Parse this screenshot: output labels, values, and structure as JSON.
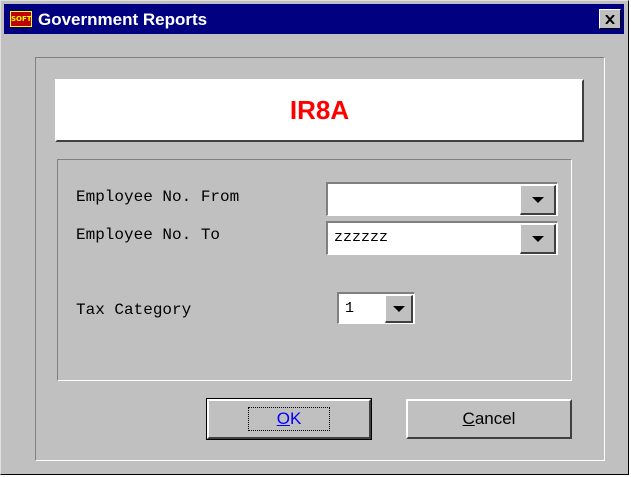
{
  "window": {
    "title": "Government Reports",
    "app_icon_text": "SOFT",
    "close_glyph": "X"
  },
  "report": {
    "title": "IR8A"
  },
  "form": {
    "employee_from": {
      "label": "Employee No. From",
      "value": ""
    },
    "employee_to": {
      "label": "Employee No. To",
      "value": "zzzzzz"
    },
    "tax_category": {
      "label": "Tax Category",
      "value": "1"
    }
  },
  "buttons": {
    "ok": {
      "label": "OK",
      "mnemonic": "O",
      "rest": "K"
    },
    "cancel": {
      "label": "Cancel",
      "mnemonic": "C",
      "rest": "ancel"
    }
  },
  "colors": {
    "titlebar": "#000080",
    "report_title": "#ff0000",
    "ok_label": "#0000ff",
    "dialog_face": "#c0c0c0"
  },
  "icons": {
    "close": "close-icon",
    "dropdown": "chevron-down-icon",
    "app": "app-logo-icon"
  }
}
